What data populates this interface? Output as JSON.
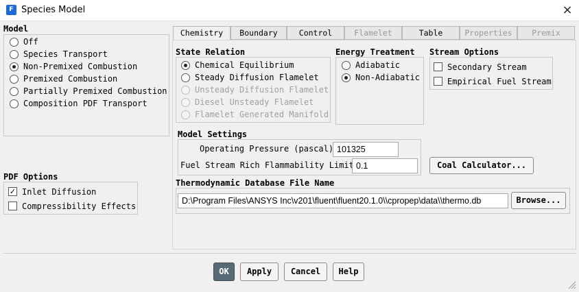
{
  "window": {
    "icon_letter": "F",
    "title": "Species Model",
    "close_glyph": "×"
  },
  "model": {
    "label": "Model",
    "options": [
      "Off",
      "Species Transport",
      "Non-Premixed Combustion",
      "Premixed Combustion",
      "Partially Premixed Combustion",
      "Composition PDF Transport"
    ],
    "selected": "Non-Premixed Combustion"
  },
  "pdf_options": {
    "label": "PDF Options",
    "inlet_diffusion": {
      "label": "Inlet Diffusion",
      "checked": true,
      "glyph": "✓"
    },
    "compressibility": {
      "label": "Compressibility Effects",
      "checked": false
    }
  },
  "tabs": [
    "Chemistry",
    "Boundary",
    "Control",
    "Flamelet",
    "Table",
    "Properties",
    "Premix"
  ],
  "active_tab": "Chemistry",
  "state_relation": {
    "label": "State Relation",
    "options": [
      "Chemical Equilibrium",
      "Steady Diffusion Flamelet",
      "Unsteady Diffusion Flamelet",
      "Diesel Unsteady Flamelet",
      "Flamelet Generated Manifold"
    ],
    "selected": "Chemical Equilibrium"
  },
  "energy_treatment": {
    "label": "Energy Treatment",
    "options": [
      "Adiabatic",
      "Non-Adiabatic"
    ],
    "selected": "Non-Adiabatic"
  },
  "stream_options": {
    "label": "Stream Options",
    "secondary_stream": "Secondary Stream",
    "empirical_fuel_stream": "Empirical Fuel Stream"
  },
  "model_settings": {
    "label": "Model Settings",
    "operating_pressure_label": "Operating Pressure (pascal)",
    "operating_pressure_value": "101325",
    "rich_limit_label": "Fuel Stream Rich Flammability Limit",
    "rich_limit_value": "0.1"
  },
  "coal_calculator_label": "Coal Calculator...",
  "thermo_db": {
    "label": "Thermodynamic Database File Name",
    "path": "D:\\Program Files\\ANSYS Inc\\v201\\fluent\\fluent20.1.0\\\\cpropep\\data\\\\thermo.db",
    "browse_label": "Browse..."
  },
  "footer": {
    "ok": "OK",
    "apply": "Apply",
    "cancel": "Cancel",
    "help": "Help"
  }
}
